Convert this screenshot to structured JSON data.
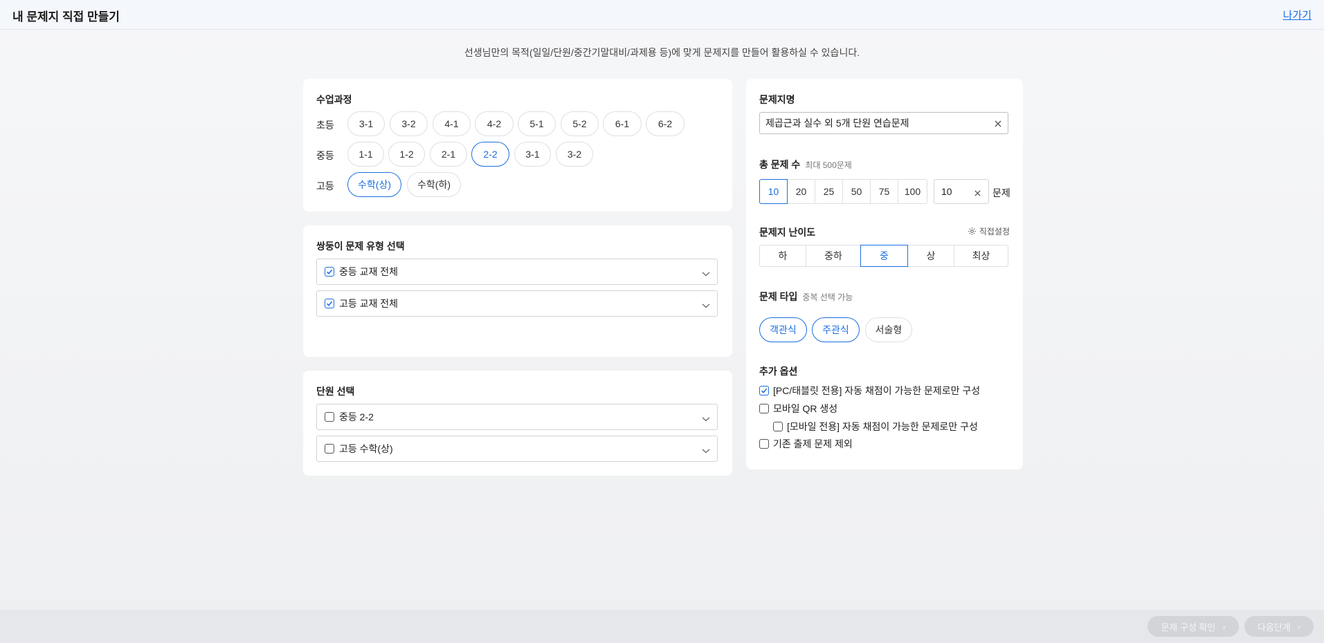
{
  "header": {
    "title": "내 문제지 직접 만들기",
    "exit_label": "나가기"
  },
  "subtitle": "선생님만의 목적(일일/단원/중간기말대비/과제용 등)에 맞게 문제지를 만들어 활용하실 수 있습니다.",
  "course": {
    "title": "수업과정",
    "rows": [
      {
        "label": "초등",
        "options": [
          "3-1",
          "3-2",
          "4-1",
          "4-2",
          "5-1",
          "5-2",
          "6-1",
          "6-2"
        ],
        "selected": []
      },
      {
        "label": "중등",
        "options": [
          "1-1",
          "1-2",
          "2-1",
          "2-2",
          "3-1",
          "3-2"
        ],
        "selected": [
          "2-2"
        ]
      },
      {
        "label": "고등",
        "options": [
          "수학(상)",
          "수학(하)"
        ],
        "selected": [
          "수학(상)"
        ]
      }
    ]
  },
  "problem_type": {
    "title": "쌍둥이 문제 유형 선택",
    "items": [
      {
        "label": "중등 교재 전체",
        "checked": true
      },
      {
        "label": "고등 교재 전체",
        "checked": true
      }
    ]
  },
  "unit": {
    "title": "단원 선택",
    "items": [
      {
        "label": "중등 2-2",
        "checked": false
      },
      {
        "label": "고등 수학(상)",
        "checked": false
      }
    ]
  },
  "settings": {
    "name_title": "문제지명",
    "name_value": "제곱근과 실수 외 5개 단원 연습문제",
    "count_title": "총 문제 수",
    "count_hint": "최대 500문제",
    "count_options": [
      "10",
      "20",
      "25",
      "50",
      "75",
      "100"
    ],
    "count_selected": "10",
    "count_input": "10",
    "count_unit": "문제",
    "difficulty_title": "문제지 난이도",
    "difficulty_custom": "직접설정",
    "difficulty_options": [
      "하",
      "중하",
      "중",
      "상",
      "최상"
    ],
    "difficulty_selected": "중",
    "qtype_title": "문제 타입",
    "qtype_hint": "중복 선택 가능",
    "qtype_options": [
      "객관식",
      "주관식",
      "서술형"
    ],
    "qtype_selected": [
      "객관식",
      "주관식"
    ],
    "extra_title": "추가 옵션",
    "extra_options": [
      {
        "label": "[PC/태블릿 전용] 자동 채점이 가능한 문제로만 구성",
        "checked": true
      },
      {
        "label": "모바일 QR 생성",
        "checked": false
      },
      {
        "label": "[모바일 전용] 자동 채점이 가능한 문제로만 구성",
        "checked": false
      },
      {
        "label": "기존 출제 문제 제외",
        "checked": false
      }
    ]
  },
  "footer": {
    "confirm_label": "문제 구성 확인",
    "next_label": "다음단계"
  },
  "colors": {
    "accent": "#1a6ee0",
    "disabled_button": "#d2d4d8"
  }
}
